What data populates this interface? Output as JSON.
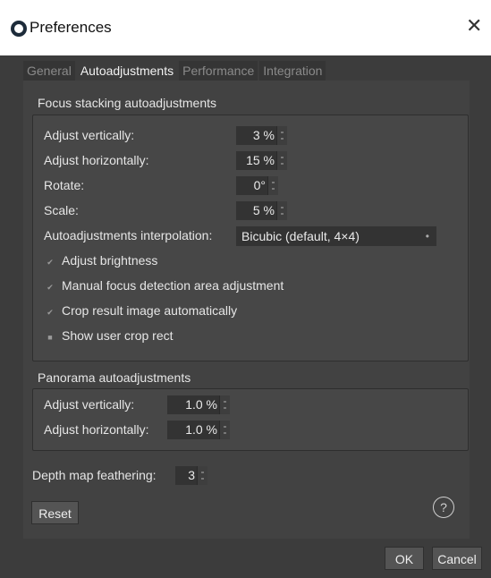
{
  "window": {
    "title": "Preferences",
    "close_glyph": "✕"
  },
  "tabs": [
    {
      "label": "General",
      "active": false
    },
    {
      "label": "Autoadjustments",
      "active": true
    },
    {
      "label": "Performance",
      "active": false
    },
    {
      "label": "Integration",
      "active": false
    }
  ],
  "focus": {
    "title": "Focus stacking autoadjustments",
    "adjust_vertically": {
      "label": "Adjust vertically:",
      "value": "3 %"
    },
    "adjust_horizontally": {
      "label": "Adjust horizontally:",
      "value": "15 %"
    },
    "rotate": {
      "label": "Rotate:",
      "value": "0°"
    },
    "scale": {
      "label": "Scale:",
      "value": "5 %"
    },
    "interpolation": {
      "label": "Autoadjustments interpolation:",
      "value": "Bicubic (default, 4×4)"
    },
    "checks": [
      {
        "label": "Adjust brightness",
        "checked": true
      },
      {
        "label": "Manual focus detection area adjustment",
        "checked": true
      },
      {
        "label": "Crop result image automatically",
        "checked": true
      },
      {
        "label": "Show user crop rect",
        "checked": false
      }
    ]
  },
  "panorama": {
    "title": "Panorama autoadjustments",
    "adjust_vertically": {
      "label": "Adjust vertically:",
      "value": "1.0 %"
    },
    "adjust_horizontally": {
      "label": "Adjust horizontally:",
      "value": "1.0 %"
    }
  },
  "depth_map": {
    "label": "Depth map feathering:",
    "value": "3"
  },
  "buttons": {
    "reset": "Reset",
    "ok": "OK",
    "cancel": "Cancel",
    "help": "?"
  },
  "glyphs": {
    "checked": "✔",
    "unchecked": "■",
    "dropdown": "•"
  }
}
